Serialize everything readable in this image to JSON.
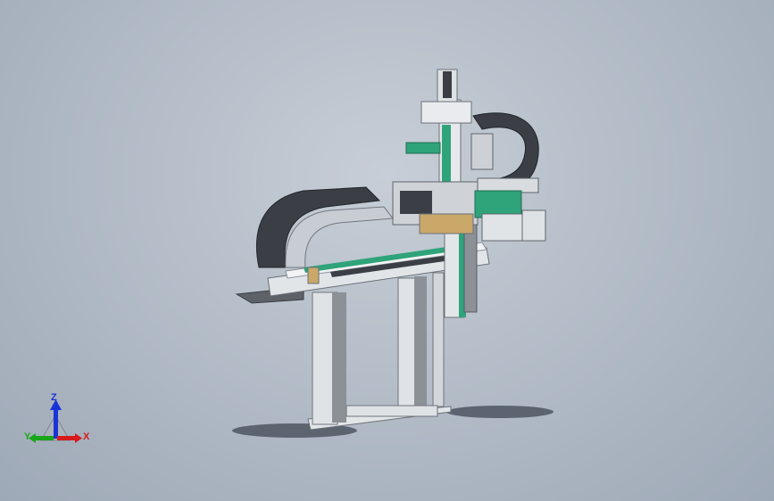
{
  "triad": {
    "z_label": "Z",
    "x_label": "X",
    "y_label": "Y",
    "colors": {
      "z": "#1a33d6",
      "x": "#d61a1a",
      "y": "#1aa61a"
    }
  },
  "model": {
    "colors": {
      "frame": "#d9dcdf",
      "frame_dark": "#7d8288",
      "green_plate": "#2fa37a",
      "cable_chain": "#3b3f45",
      "shadow": "#4d5561"
    }
  }
}
